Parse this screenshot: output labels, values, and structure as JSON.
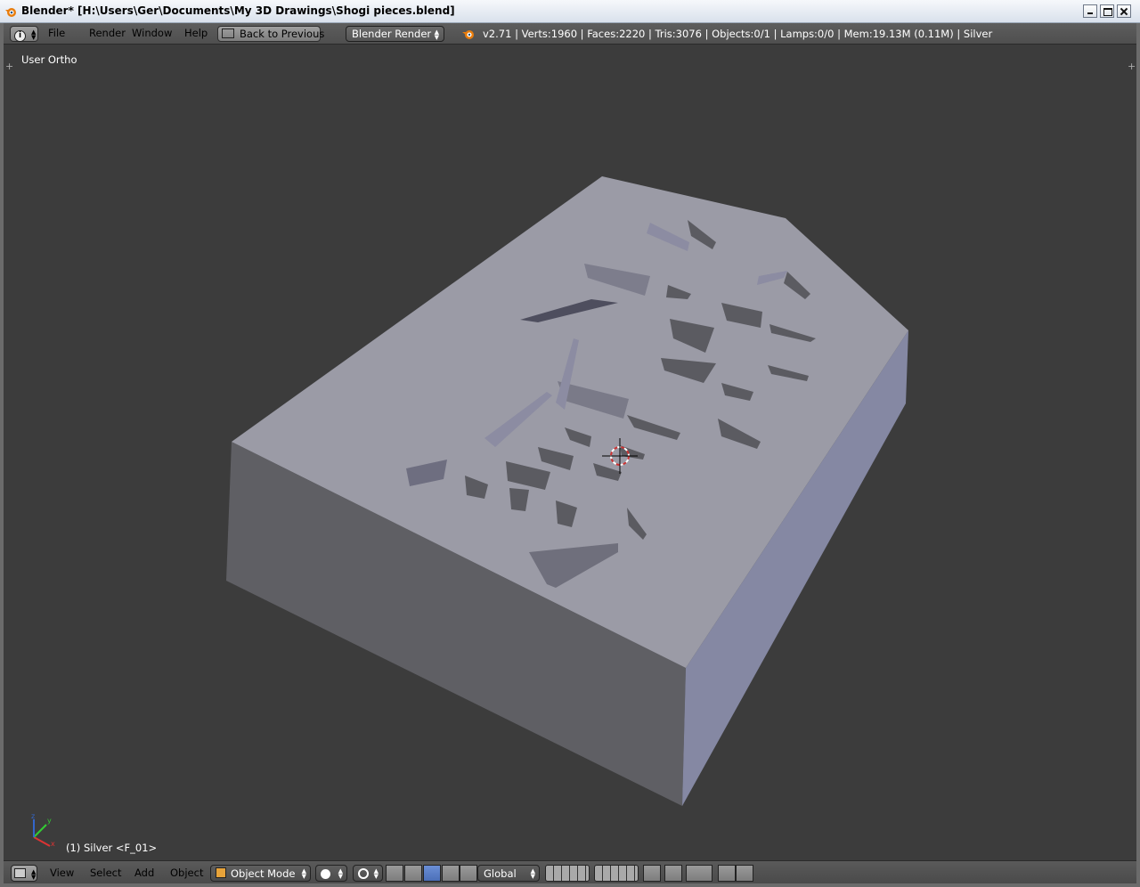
{
  "window": {
    "title": "Blender* [H:\\Users\\Ger\\Documents\\My 3D Drawings\\Shogi pieces.blend]"
  },
  "header": {
    "menus": [
      "File",
      "Render",
      "Window",
      "Help"
    ],
    "back_button": "Back to Previous",
    "render_engine": "Blender Render",
    "stats": "v2.71 | Verts:1960 | Faces:2220 | Tris:3076 | Objects:0/1 | Lamps:0/0 | Mem:19.13M (0.11M) | Silver"
  },
  "viewport": {
    "view_name": "User Ortho",
    "object_label": "(1) Silver <F_01>",
    "axes": {
      "x": "x",
      "y": "y",
      "z": "z"
    }
  },
  "footer": {
    "menus": [
      "View",
      "Select",
      "Add",
      "Object"
    ],
    "mode": "Object Mode",
    "orientation": "Global"
  },
  "colors": {
    "viewport_bg": "#3c3c3c",
    "piece_top": "#9b9ba6",
    "piece_front": "#5f5f64",
    "piece_side": "#8487a0",
    "accent_blue": "#5b7fcf"
  },
  "icons": [
    "blender-logo-icon",
    "info-editor-icon",
    "back-icon",
    "render-icon",
    "view3d-editor-icon",
    "object-mode-icon",
    "viewport-shading-icon",
    "pivot-icon",
    "manipulator-icon",
    "translate-icon",
    "rotate-icon",
    "scale-icon",
    "layers-icon",
    "lock-icon",
    "snap-icon",
    "render-preview-icon"
  ]
}
